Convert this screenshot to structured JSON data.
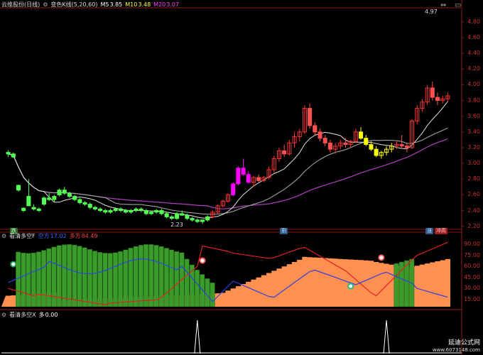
{
  "panel1": {
    "stock_name": "云维股份(日线)",
    "indicator_name": "变色K线(5,20,60)",
    "ma5_label": "M5",
    "ma5_value": "3.85",
    "ma10_label": "M10",
    "ma10_value": "3.48",
    "ma20_label": "M20",
    "ma20_value": "3.07",
    "high_label": "4.97",
    "low_label": "2.23",
    "y_ticks": [
      "4.80",
      "4.60",
      "4.40",
      "4.20",
      "4.00",
      "3.80",
      "3.60",
      "3.40",
      "3.20",
      "3.00",
      "2.80",
      "2.60",
      "2.40",
      "2.20"
    ],
    "bottom_tags": [
      "跌",
      "割",
      "涨",
      "冲高"
    ]
  },
  "panel2": {
    "title": "看清多空F",
    "line1_label": "空方",
    "line1_value": "17.02",
    "line2_label": "多方",
    "line2_value": "84.49",
    "y_ticks": [
      "90.00",
      "75.00",
      "60.00",
      "45.00",
      "30.00",
      "15.00"
    ]
  },
  "panel3": {
    "title": "看清多空X",
    "line_label": "多",
    "line_value": "0.00"
  },
  "watermark": {
    "line1": "延迪公式网",
    "line2": "www.6073148.com"
  },
  "colors": {
    "up": "#ff3232",
    "down": "#54ff54",
    "yellow": "#ffff00",
    "magenta": "#ff00ff",
    "ma_white": "#e0e0e0",
    "ma_gray": "#a0a0a0",
    "ma_purple": "#b040c0",
    "bull_green": "#3a9a2a",
    "bear_orange": "#ff9050",
    "red_line": "#e02020",
    "blue_line": "#3040e0"
  },
  "chart_data": {
    "type": "candlestick",
    "candles": [
      [
        3.14,
        3.17,
        3.08,
        3.12
      ],
      [
        3.12,
        3.14,
        3.07,
        3.08
      ],
      [
        2.72,
        2.73,
        2.64,
        2.66
      ],
      [
        2.4,
        2.44,
        2.38,
        2.43
      ],
      [
        2.58,
        2.8,
        2.46,
        2.46
      ],
      [
        2.44,
        2.48,
        2.4,
        2.42
      ],
      [
        2.42,
        2.44,
        2.38,
        2.4
      ],
      [
        2.48,
        2.58,
        2.46,
        2.56
      ],
      [
        2.56,
        2.62,
        2.52,
        2.54
      ],
      [
        2.54,
        2.6,
        2.5,
        2.58
      ],
      [
        2.6,
        2.68,
        2.58,
        2.66
      ],
      [
        2.66,
        2.7,
        2.6,
        2.62
      ],
      [
        2.62,
        2.64,
        2.56,
        2.58
      ],
      [
        2.58,
        2.6,
        2.52,
        2.54
      ],
      [
        2.54,
        2.56,
        2.48,
        2.5
      ],
      [
        2.5,
        2.52,
        2.46,
        2.48
      ],
      [
        2.48,
        2.5,
        2.42,
        2.44
      ],
      [
        2.44,
        2.46,
        2.4,
        2.42
      ],
      [
        2.42,
        2.44,
        2.38,
        2.4
      ],
      [
        2.4,
        2.42,
        2.36,
        2.38
      ],
      [
        2.38,
        2.42,
        2.36,
        2.4
      ],
      [
        2.4,
        2.44,
        2.38,
        2.42
      ],
      [
        2.42,
        2.44,
        2.38,
        2.4
      ],
      [
        2.4,
        2.42,
        2.36,
        2.38
      ],
      [
        2.38,
        2.42,
        2.36,
        2.4
      ],
      [
        2.4,
        2.44,
        2.38,
        2.42
      ],
      [
        2.42,
        2.44,
        2.38,
        2.4
      ],
      [
        2.4,
        2.42,
        2.34,
        2.36
      ],
      [
        2.36,
        2.4,
        2.34,
        2.38
      ],
      [
        2.38,
        2.42,
        2.36,
        2.4
      ],
      [
        2.4,
        2.42,
        2.34,
        2.36
      ],
      [
        2.36,
        2.38,
        2.3,
        2.32
      ],
      [
        2.32,
        2.34,
        2.28,
        2.3
      ],
      [
        2.3,
        2.38,
        2.28,
        2.36
      ],
      [
        2.36,
        2.4,
        2.34,
        2.34
      ],
      [
        2.34,
        2.36,
        2.28,
        2.3
      ],
      [
        2.3,
        2.32,
        2.26,
        2.28
      ],
      [
        2.28,
        2.3,
        2.24,
        2.26
      ],
      [
        2.26,
        2.28,
        2.23,
        2.28
      ],
      [
        2.28,
        2.34,
        2.26,
        2.32
      ],
      [
        2.32,
        2.4,
        2.3,
        2.38
      ],
      [
        2.38,
        2.48,
        2.36,
        2.46
      ],
      [
        2.46,
        2.54,
        2.44,
        2.52
      ],
      [
        2.52,
        2.62,
        2.5,
        2.6
      ],
      [
        2.6,
        2.76,
        2.58,
        2.74
      ],
      [
        2.74,
        2.96,
        2.72,
        2.94
      ],
      [
        2.94,
        3.06,
        2.84,
        2.86
      ],
      [
        2.86,
        2.9,
        2.74,
        2.76
      ],
      [
        2.76,
        2.84,
        2.7,
        2.82
      ],
      [
        2.82,
        2.86,
        2.76,
        2.78
      ],
      [
        2.78,
        2.84,
        2.76,
        2.82
      ],
      [
        2.82,
        2.96,
        2.8,
        2.92
      ],
      [
        2.92,
        3.1,
        2.88,
        3.06
      ],
      [
        3.06,
        3.2,
        3.02,
        3.16
      ],
      [
        3.16,
        3.24,
        3.08,
        3.12
      ],
      [
        3.12,
        3.3,
        3.1,
        3.26
      ],
      [
        3.26,
        3.4,
        3.2,
        3.34
      ],
      [
        3.34,
        3.44,
        3.28,
        3.4
      ],
      [
        3.4,
        3.74,
        3.38,
        3.7
      ],
      [
        3.7,
        3.76,
        3.44,
        3.48
      ],
      [
        3.48,
        3.52,
        3.36,
        3.4
      ],
      [
        3.4,
        3.44,
        3.28,
        3.32
      ],
      [
        3.32,
        3.36,
        3.22,
        3.26
      ],
      [
        3.26,
        3.3,
        3.14,
        3.18
      ],
      [
        3.18,
        3.26,
        3.12,
        3.22
      ],
      [
        3.22,
        3.3,
        3.18,
        3.26
      ],
      [
        3.26,
        3.32,
        3.2,
        3.24
      ],
      [
        3.24,
        3.3,
        3.2,
        3.28
      ],
      [
        3.28,
        3.44,
        3.26,
        3.4
      ],
      [
        3.4,
        3.46,
        3.3,
        3.32
      ],
      [
        3.32,
        3.36,
        3.22,
        3.24
      ],
      [
        3.24,
        3.28,
        3.16,
        3.18
      ],
      [
        3.18,
        3.22,
        3.08,
        3.1
      ],
      [
        3.1,
        3.16,
        3.06,
        3.14
      ],
      [
        3.14,
        3.22,
        3.1,
        3.18
      ],
      [
        3.18,
        3.26,
        3.14,
        3.22
      ],
      [
        3.22,
        3.28,
        3.18,
        3.24
      ],
      [
        3.24,
        3.36,
        3.2,
        3.22
      ],
      [
        3.22,
        3.26,
        3.14,
        3.2
      ],
      [
        3.2,
        3.56,
        3.18,
        3.54
      ],
      [
        3.54,
        3.74,
        3.5,
        3.7
      ],
      [
        3.7,
        3.82,
        3.66,
        3.78
      ],
      [
        3.78,
        4.0,
        3.74,
        3.96
      ],
      [
        3.96,
        4.04,
        3.8,
        3.84
      ],
      [
        3.84,
        3.9,
        3.74,
        3.8
      ],
      [
        3.8,
        3.86,
        3.76,
        3.82
      ],
      [
        3.82,
        3.9,
        3.78,
        3.86
      ]
    ],
    "y_range": [
      2.17,
      4.97
    ]
  }
}
